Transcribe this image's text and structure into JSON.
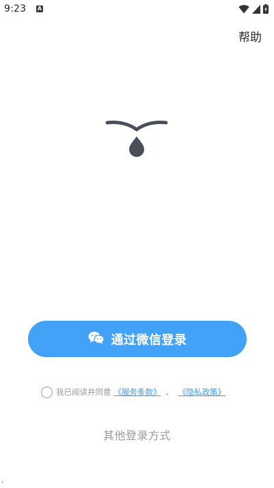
{
  "status_bar": {
    "time": "9:23",
    "notification_glyph": "A",
    "icons": [
      "wifi-icon",
      "signal-icon",
      "battery-charging-icon"
    ]
  },
  "header": {
    "help_label": "帮助"
  },
  "logo": {
    "icon": "drip-logo-icon",
    "color": "#4a4e59"
  },
  "login": {
    "wechat_label": "通过微信登录",
    "wechat_icon": "wechat-icon",
    "button_color": "#41a2f7"
  },
  "agreement": {
    "prefix": "我已阅读并同意",
    "terms_label": "《服务条款》",
    "separator": "、",
    "privacy_label": "《隐私政策》",
    "link_color": "#3a9af5"
  },
  "other_login": {
    "label": "其他登录方式"
  },
  "corner_mark": "'"
}
